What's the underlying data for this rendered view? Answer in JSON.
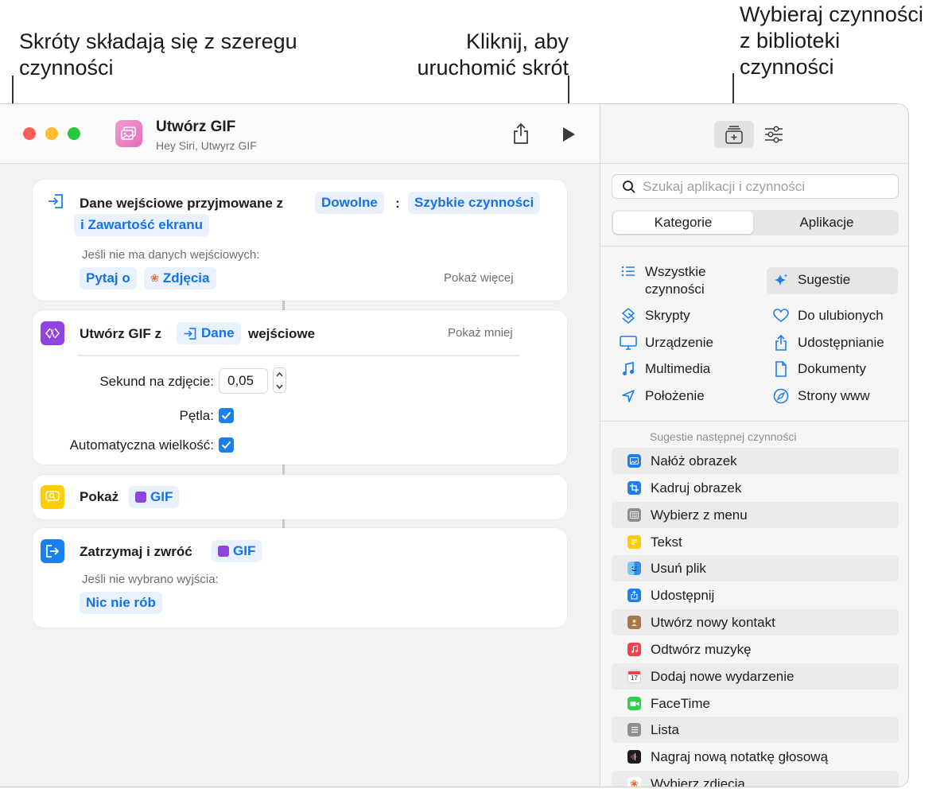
{
  "callouts": {
    "left": [
      "Skróty składają się z szeregu",
      "czynności"
    ],
    "middle": [
      "Kliknij, aby",
      "uruchomić skrót"
    ],
    "right": [
      "Wybieraj czynności",
      "z biblioteki",
      "czynności"
    ]
  },
  "window": {
    "title": "Utwórz GIF",
    "subtitle": "Hey Siri, Utwyrz GIF"
  },
  "actions": {
    "input": {
      "title": "Dane wejściowe przyjmowane z",
      "token_any": "Dowolne",
      "colon": ":",
      "token_sources_line1": "Szybkie czynności",
      "token_sources_line2": "i Zawartość ekranu",
      "no_input_label": "Jeśli nie ma danych wejściowych:",
      "token_ask": "Pytaj o",
      "token_photos": "Zdjęcia",
      "show_more": "Pokaż więcej"
    },
    "make_gif": {
      "title_prefix": "Utwórz GIF z",
      "token_input": "Dane",
      "title_suffix": "wejściowe",
      "show_less": "Pokaż mniej",
      "seconds_label": "Sekund na zdjęcie:",
      "seconds_value": "0,05",
      "loop_label": "Pętla:",
      "loop_checked": true,
      "autosize_label": "Automatyczna wielkość:",
      "autosize_checked": true
    },
    "show": {
      "title": "Pokaż",
      "token": "GIF"
    },
    "stop": {
      "title": "Zatrzymaj i zwróć",
      "token": "GIF",
      "no_output_label": "Jeśli nie wybrano wyjścia:",
      "token_do_nothing": "Nic nie rób"
    }
  },
  "library": {
    "search_placeholder": "Szukaj aplikacji i czynności",
    "segments": [
      "Kategorie",
      "Aplikacje"
    ],
    "selected_segment": "Kategorie",
    "categories_left": [
      {
        "label_line1": "Wszystkie",
        "label_line2": "czynności",
        "icon": "list-icon"
      },
      {
        "label": "Skrypty",
        "icon": "scripts-icon"
      },
      {
        "label": "Urządzenie",
        "icon": "monitor-icon"
      },
      {
        "label": "Multimedia",
        "icon": "music-note-icon"
      },
      {
        "label": "Położenie",
        "icon": "location-arrow-icon"
      }
    ],
    "categories_right": [
      {
        "label": "Sugestie",
        "icon": "sparkle-icon",
        "selected": true
      },
      {
        "label": "Do ulubionych",
        "icon": "heart-icon"
      },
      {
        "label": "Udostępnianie",
        "icon": "share-icon"
      },
      {
        "label": "Dokumenty",
        "icon": "document-icon"
      },
      {
        "label": "Strony www",
        "icon": "compass-icon"
      }
    ],
    "suggestions_header": "Sugestie następnej czynności",
    "suggestions": [
      {
        "label": "Nałóż obrazek",
        "icon": "overlay-image-icon",
        "color": "#1a7ff0"
      },
      {
        "label": "Kadruj obrazek",
        "icon": "crop-icon",
        "color": "#1a7ff0"
      },
      {
        "label": "Wybierz z menu",
        "icon": "menu-icon",
        "color": "#8e8e93"
      },
      {
        "label": "Tekst",
        "icon": "text-icon",
        "color": "#ffcc00"
      },
      {
        "label": "Usuń plik",
        "icon": "finder-icon",
        "color": "#2f8cf0"
      },
      {
        "label": "Udostępnij",
        "icon": "share-icon",
        "color": "#1a7ff0"
      },
      {
        "label": "Utwórz nowy kontakt",
        "icon": "contacts-icon",
        "color": "#a5774b"
      },
      {
        "label": "Odtwórz muzykę",
        "icon": "music-icon",
        "color": "#fa3c4c"
      },
      {
        "label": "Dodaj nowe wydarzenie",
        "icon": "calendar-icon",
        "color": "#ffffff"
      },
      {
        "label": "FaceTime",
        "icon": "facetime-icon",
        "color": "#2fcf4f"
      },
      {
        "label": "Lista",
        "icon": "list-icon",
        "color": "#8e8e93"
      },
      {
        "label": "Nagraj nową notatkę głosową",
        "icon": "voice-memo-icon",
        "color": "#1c1c1e"
      },
      {
        "label": "Wybierz zdjęcia",
        "icon": "photos-icon",
        "color": "#ffffff"
      }
    ]
  },
  "colors": {
    "accent": "#1a7ff0",
    "token_bg": "#e8f1fd",
    "gif_purple": "#8e44e0",
    "show_yellow": "#ffcc00"
  }
}
